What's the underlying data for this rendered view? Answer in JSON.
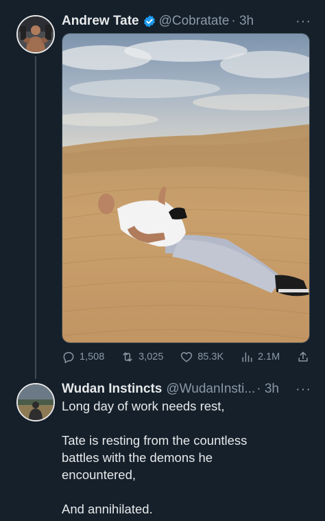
{
  "colors": {
    "background": "#15202b",
    "text": "#e7e9ea",
    "muted": "#8b98a5",
    "verified": "#1d9bf0",
    "divider": "#38444d"
  },
  "tweet": {
    "author_name": "Andrew Tate",
    "verified_icon": "verified-badge-icon",
    "handle": "@Cobratate",
    "time": "· 3h",
    "more_icon": "more-options-icon",
    "more_label": "···",
    "media_description_icon": "photo",
    "stats": {
      "replies": "1,508",
      "retweets": "3,025",
      "likes": "85.3K",
      "views": "2.1M"
    },
    "icons": [
      "reply-icon",
      "retweet-icon",
      "like-icon",
      "views-icon",
      "share-icon"
    ]
  },
  "reply": {
    "author_name": "Wudan Instincts",
    "handle": "@WudanInsti...",
    "time": "· 3h",
    "more_label": "···",
    "lines": [
      "Long day of work needs rest,",
      "",
      "Tate is resting from the countless",
      "battles with the demons he",
      "encountered,",
      "",
      "And annihilated."
    ]
  }
}
